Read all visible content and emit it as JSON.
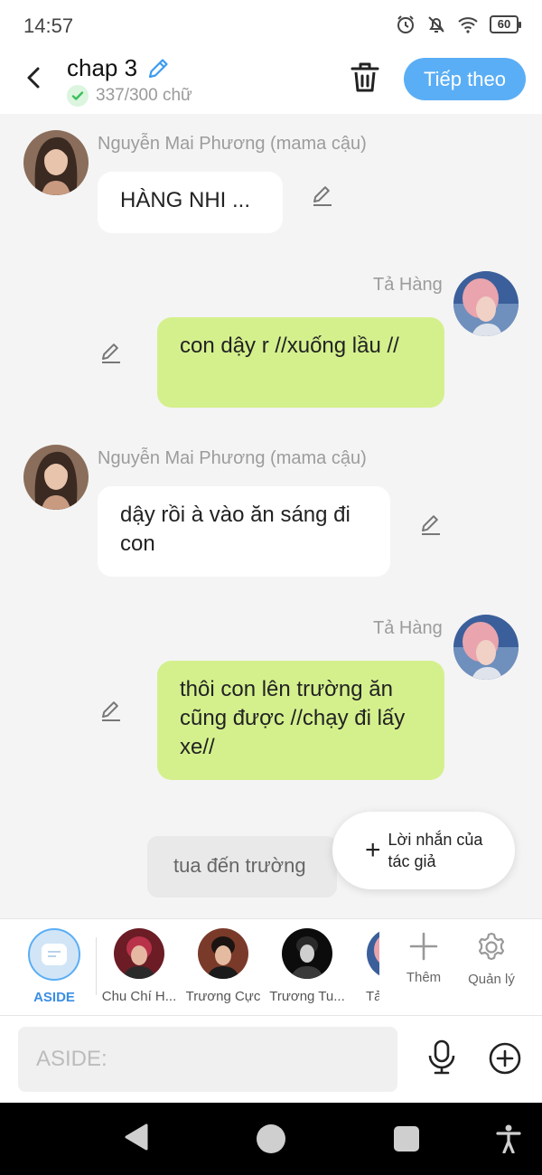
{
  "status_bar": {
    "time": "14:57",
    "battery": "60"
  },
  "header": {
    "title": "chap 3",
    "word_count": "337/300 chữ",
    "next_label": "Tiếp theo"
  },
  "messages": [
    {
      "side": "left",
      "sender": "Nguyễn Mai Phương (mama cậu)",
      "text": "HÀNG NHI ..."
    },
    {
      "side": "right",
      "sender": "Tả Hàng",
      "text": "con dậy r //xuống lầu //"
    },
    {
      "side": "left",
      "sender": "Nguyễn Mai Phương (mama cậu)",
      "text": "dậy rồi à vào ăn sáng đi con"
    },
    {
      "side": "right",
      "sender": "Tả Hàng",
      "text": "thôi con lên trường ăn cũng được //chạy đi lấy xe//"
    }
  ],
  "narration": "tua đến trường",
  "author_note_label": "Lời nhắn của tác giả",
  "characters": [
    {
      "name": "ASIDE"
    },
    {
      "name": "Chu Chí H..."
    },
    {
      "name": "Trương Cực"
    },
    {
      "name": "Trương Tu..."
    },
    {
      "name": "Tả"
    }
  ],
  "tools": {
    "add_label": "Thêm",
    "manage_label": "Quản lý"
  },
  "input": {
    "placeholder": "ASIDE:"
  },
  "colors": {
    "accent": "#5aaef5",
    "right_bubble": "#d4f08d",
    "left_bubble": "#ffffff",
    "check": "#3cbf5c"
  }
}
